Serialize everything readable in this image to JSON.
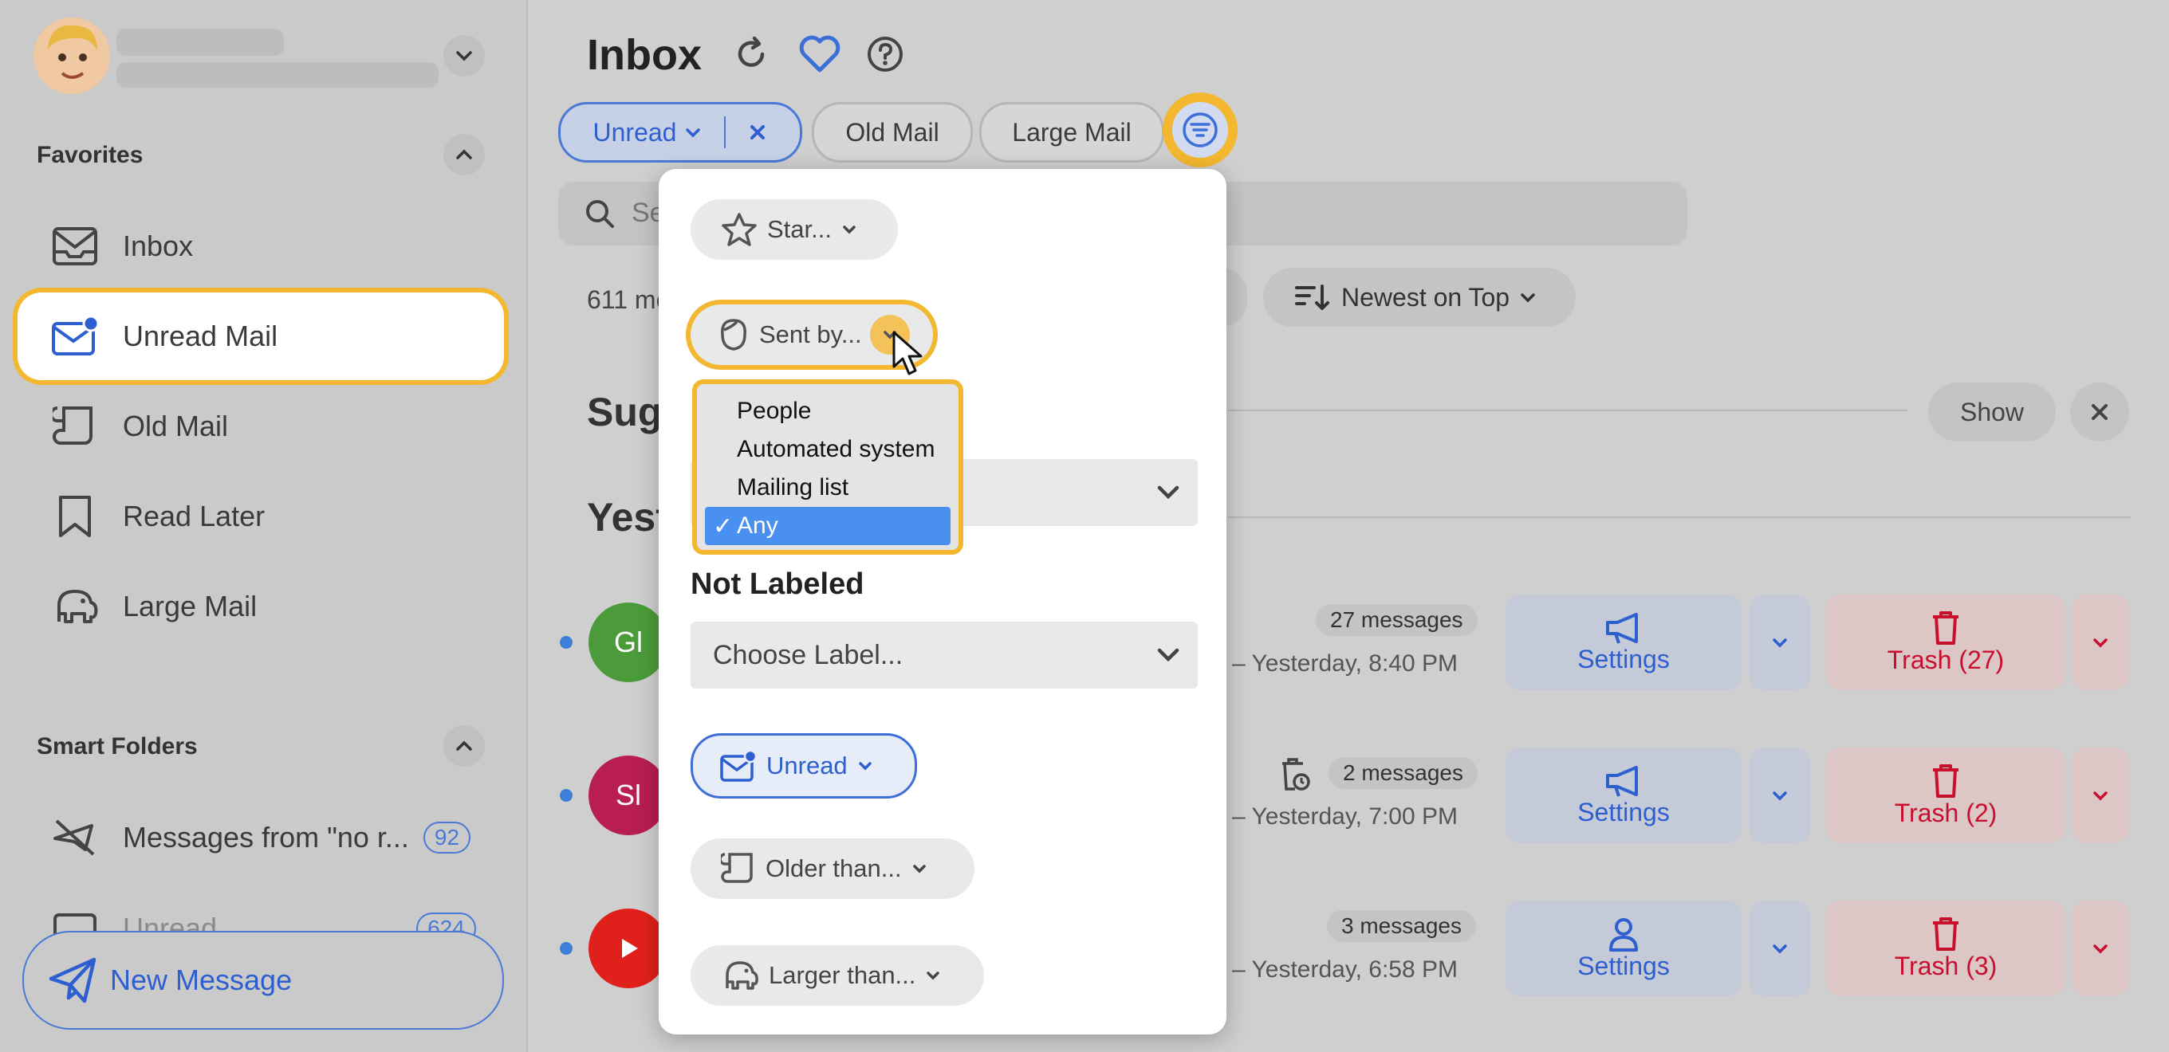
{
  "sidebar": {
    "favorites_title": "Favorites",
    "items": [
      {
        "label": "Inbox",
        "icon": "inbox-icon"
      },
      {
        "label": "Unread Mail",
        "icon": "unread-mail-icon"
      },
      {
        "label": "Old Mail",
        "icon": "scroll-icon"
      },
      {
        "label": "Read Later",
        "icon": "bookmark-icon"
      },
      {
        "label": "Large Mail",
        "icon": "elephant-icon"
      }
    ],
    "smart_title": "Smart Folders",
    "smart_items": [
      {
        "label": "Messages from \"no r...",
        "count": "92"
      },
      {
        "label": "Unread",
        "count": "624"
      }
    ],
    "new_message": "New Message"
  },
  "header": {
    "title": "Inbox",
    "chips": {
      "unread": "Unread",
      "old": "Old Mail",
      "large": "Large Mail"
    }
  },
  "main": {
    "search_placeholder": "Se",
    "count_text": "611 me",
    "sort": "Newest on Top",
    "suggest_heading": "Sug",
    "yesterday_heading": "Yest",
    "show": "Show",
    "rows": [
      {
        "avatar": "Gl",
        "avatar_color": "#4b9b3a",
        "badge": "27 messages",
        "time": "0 – Yesterday, 8:40 PM",
        "settings": "Settings",
        "trash": "Trash (27)",
        "icon": "megaphone-icon"
      },
      {
        "avatar": "Sl",
        "avatar_color": "#b81e4f",
        "badge": "2 messages",
        "time": "3 – Yesterday, 7:00 PM",
        "settings": "Settings",
        "trash": "Trash (2)",
        "icon": "megaphone-icon"
      },
      {
        "avatar": "",
        "avatar_color": "#e0201a",
        "badge": "3 messages",
        "time": "3 – Yesterday, 6:58 PM",
        "settings": "Settings",
        "trash": "Trash (3)",
        "icon": "person-icon"
      }
    ]
  },
  "popover": {
    "star": "Star...",
    "sent_by": "Sent by...",
    "options": [
      "People",
      "Automated system",
      "Mailing list",
      "Any"
    ],
    "selected": "Any",
    "check": "✓",
    "not_labeled": "Not Labeled",
    "choose_label": "Choose Label...",
    "unread": "Unread",
    "older": "Older than...",
    "larger": "Larger than..."
  },
  "colors": {
    "accent": "#2d5fd0",
    "highlight": "#f3b730",
    "danger": "#c8102e"
  }
}
